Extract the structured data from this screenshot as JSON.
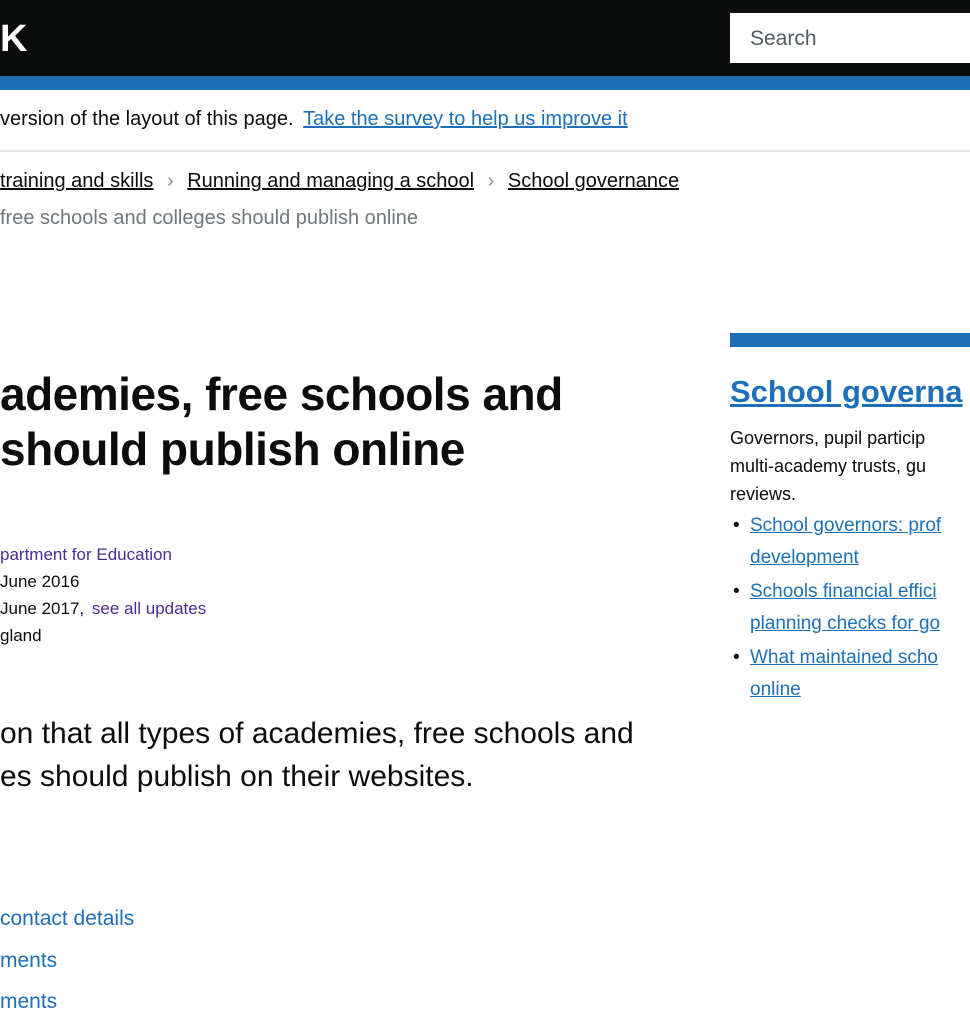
{
  "header": {
    "logo_text": "K",
    "search_placeholder": "Search"
  },
  "survey": {
    "text": "version of the layout of this page.",
    "link": "Take the survey to help us improve it"
  },
  "breadcrumb": {
    "items": [
      "training and skills",
      "Running and managing a school",
      "School governance"
    ],
    "separator": ">",
    "current": "free schools and colleges should publish online"
  },
  "title": {
    "line1": "ademies, free schools and",
    "line2": "should publish online"
  },
  "meta": {
    "from": "partment for Education",
    "published": "June 2016",
    "updated": "June 2017,",
    "updated_link": "see all updates",
    "applies_to": "gland"
  },
  "lead": {
    "line1": "on that all types of academies, free schools and",
    "line2": "es should publish on their websites."
  },
  "contents": [
    "contact details",
    "ments",
    "ments"
  ],
  "related": {
    "title": "School governa",
    "description": [
      "Governors, pupil particip",
      "multi-academy trusts, gu",
      "reviews."
    ],
    "links": [
      [
        "School governors: prof",
        "development"
      ],
      [
        "Schools financial effici",
        "planning checks for go"
      ],
      [
        "What maintained scho",
        "online"
      ]
    ]
  },
  "colors": {
    "header_bg": "#0b0c0c",
    "brand_blue": "#1d70b8",
    "meta_link": "#4c2c92"
  }
}
